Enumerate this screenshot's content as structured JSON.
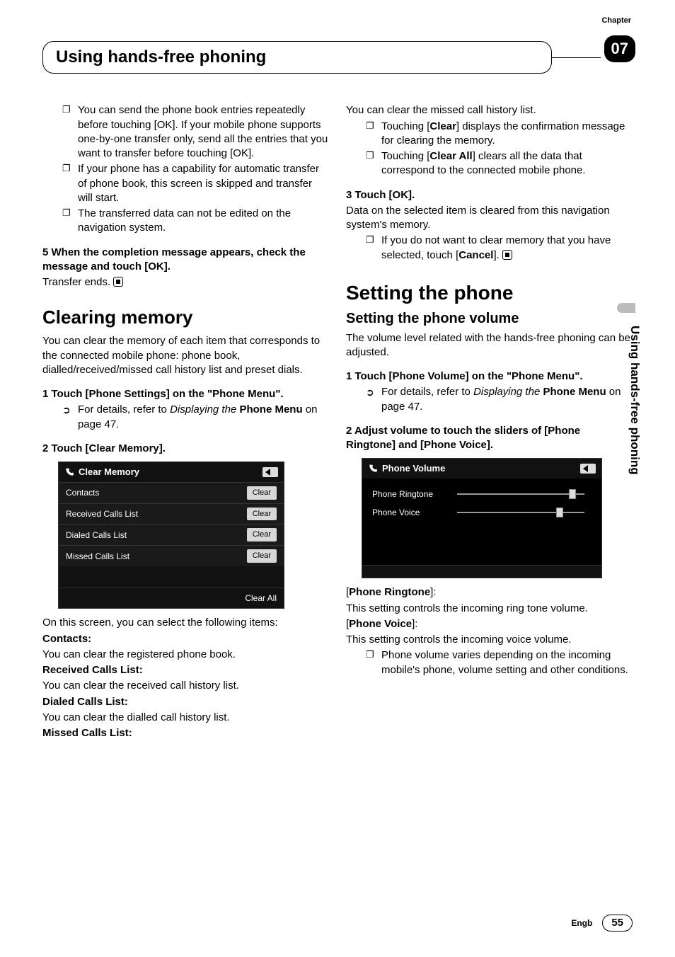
{
  "chapter_label": "Chapter",
  "chapter_number": "07",
  "header_title": "Using hands-free phoning",
  "side_tab": "Using hands-free phoning",
  "left": {
    "bullets_top": [
      "You can send the phone book entries repeatedly before touching [OK]. If your mobile phone supports one-by-one transfer only, send all the entries that you want to transfer before touching [OK].",
      "If your phone has a capability for automatic transfer of phone book, this screen is skipped and transfer will start.",
      "The transferred data can not be edited on the navigation system."
    ],
    "step5": "5   When the completion message appears, check the message and touch [OK].",
    "step5_after": "Transfer ends.",
    "h_clearing": "Clearing memory",
    "clearing_intro": "You can clear the memory of each item that corresponds to the connected mobile phone: phone book, dialled/received/missed call history list and preset dials.",
    "step1": "1   Touch [Phone Settings] on the \"Phone Menu\".",
    "ref1_a": "For details, refer to ",
    "ref1_b": "Displaying the",
    "ref1_c": " Phone Menu",
    "ref1_d": " on page 47.",
    "step2": "2   Touch [Clear Memory].",
    "shot1": {
      "title": "Clear Memory",
      "rows": [
        {
          "label": "Contacts",
          "btn": "Clear"
        },
        {
          "label": "Received Calls List",
          "btn": "Clear"
        },
        {
          "label": "Dialed Calls List",
          "btn": "Clear"
        },
        {
          "label": "Missed Calls List",
          "btn": "Clear"
        }
      ],
      "footer": "Clear All"
    },
    "after_shot": "On this screen, you can select the following items:",
    "defs": [
      {
        "t": "Contacts:",
        "d": "You can clear the registered phone book."
      },
      {
        "t": "Received Calls List:",
        "d": "You can clear the received call history list."
      },
      {
        "t": "Dialed Calls List:",
        "d": "You can clear the dialled call history list."
      },
      {
        "t": "Missed Calls List:",
        "d": ""
      }
    ]
  },
  "right": {
    "intro": "You can clear the missed call history list.",
    "bullets1": [
      "Touching [Clear] displays the confirmation message for clearing the memory.",
      "Touching [Clear All] clears all the data that correspond to the connected mobile phone."
    ],
    "step3": "3   Touch [OK].",
    "step3_after": "Data on the selected item is cleared from this navigation system's memory.",
    "bullet_cancel": "If you do not want to clear memory that you have selected, touch [Cancel].",
    "h_setting": "Setting the phone",
    "h_setting_vol": "Setting the phone volume",
    "vol_intro": "The volume level related with the hands-free phoning can be adjusted.",
    "vstep1": "1   Touch [Phone Volume] on the \"Phone Menu\".",
    "vref_a": "For details, refer to ",
    "vref_b": "Displaying the",
    "vref_c": " Phone Menu",
    "vref_d": " on page 47.",
    "vstep2": "2   Adjust volume to touch the sliders of [Phone Ringtone] and [Phone Voice].",
    "shot2": {
      "title": "Phone Volume",
      "row1": "Phone Ringtone",
      "row2": "Phone Voice"
    },
    "pr_label": "[Phone Ringtone]:",
    "pr_text": "This setting controls the incoming ring tone volume.",
    "pv_label": "[Phone Voice]:",
    "pv_text": "This setting controls the incoming voice volume.",
    "bullet_vol": "Phone volume varies depending on the incoming mobile's phone, volume setting and other conditions."
  },
  "footer": {
    "lang": "Engb",
    "page": "55"
  }
}
